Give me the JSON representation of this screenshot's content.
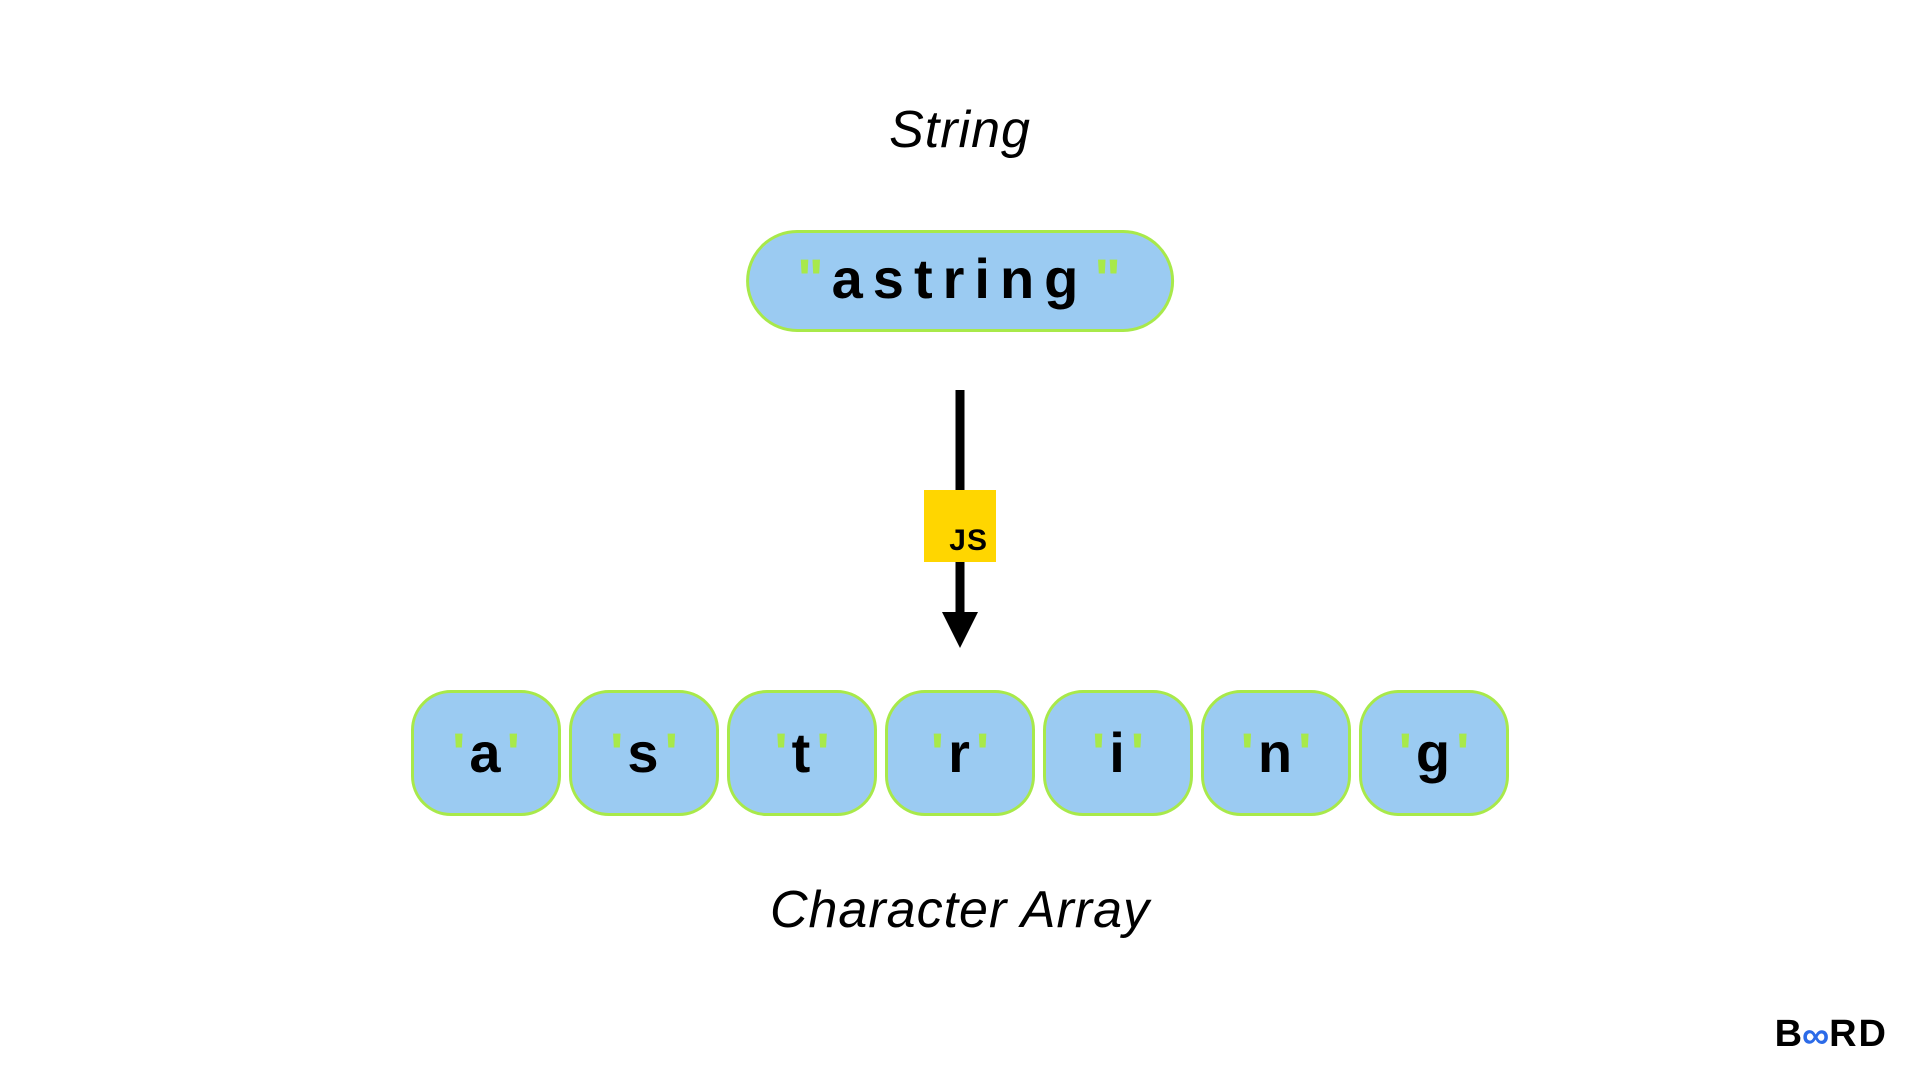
{
  "labels": {
    "top": "String",
    "bottom": "Character Array"
  },
  "stringPill": {
    "quote": "\"",
    "value": "astring"
  },
  "jsBadge": {
    "text": "JS"
  },
  "charArray": {
    "singleQuote": "'",
    "chars": [
      "a",
      "s",
      "t",
      "r",
      "i",
      "n",
      "g"
    ]
  },
  "brand": {
    "b": "B",
    "inf": "∞",
    "rd": "RD"
  }
}
